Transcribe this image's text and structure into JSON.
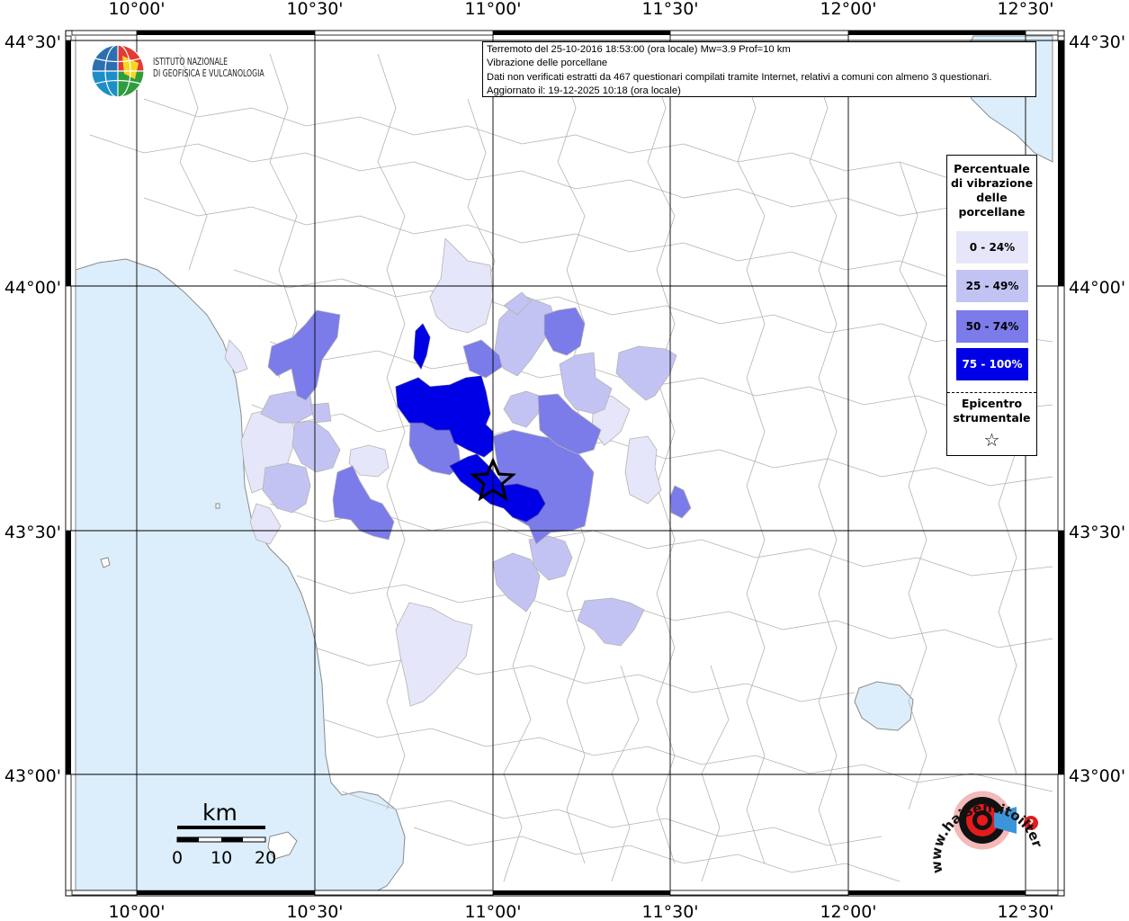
{
  "map": {
    "lon_ticks": [
      "10°00'",
      "10°30'",
      "11°00'",
      "11°30'",
      "12°00'",
      "12°30'"
    ],
    "lat_ticks": [
      "44°30'",
      "44°00'",
      "43°30'",
      "43°00'"
    ],
    "colors": {
      "sea": "#dceefb",
      "land": "#ffffff",
      "border": "#b3b3b3",
      "grid": "#000000"
    }
  },
  "info": {
    "line1": "Terremoto del 25-10-2016 18:53:00 (ora locale) Mw=3.9 Prof=10 km",
    "line2": "Vibrazione delle porcellane",
    "line3": "Dati non verificati estratti da 467 questionari compilati tramite Internet, relativi a comuni con almeno 3 questionari.",
    "line4": "Aggiornato il: 19-12-2025 10:18 (ora locale)"
  },
  "logo": {
    "line1": "ISTITUTO NAZIONALE",
    "line2": "DI GEOFISICA E VULCANOLOGIA"
  },
  "legend": {
    "title": "Percentuale di vibrazione delle porcellane",
    "classes": [
      {
        "label": "0 - 24%",
        "color": "#e6e6fa",
        "text_color": "#000000"
      },
      {
        "label": "25 - 49%",
        "color": "#c3c3f3",
        "text_color": "#000000"
      },
      {
        "label": "50 - 74%",
        "color": "#7b7bea",
        "text_color": "#000000"
      },
      {
        "label": "75 - 100%",
        "color": "#0000e6",
        "text_color": "#ffffff"
      }
    ],
    "epicenter_label": "Epicentro strumentale",
    "epicenter_symbol": "☆"
  },
  "scale": {
    "title": "km",
    "labels": [
      "0",
      "10",
      "20"
    ]
  },
  "badge": {
    "text": "www.haisentitoilterremoto.it"
  }
}
